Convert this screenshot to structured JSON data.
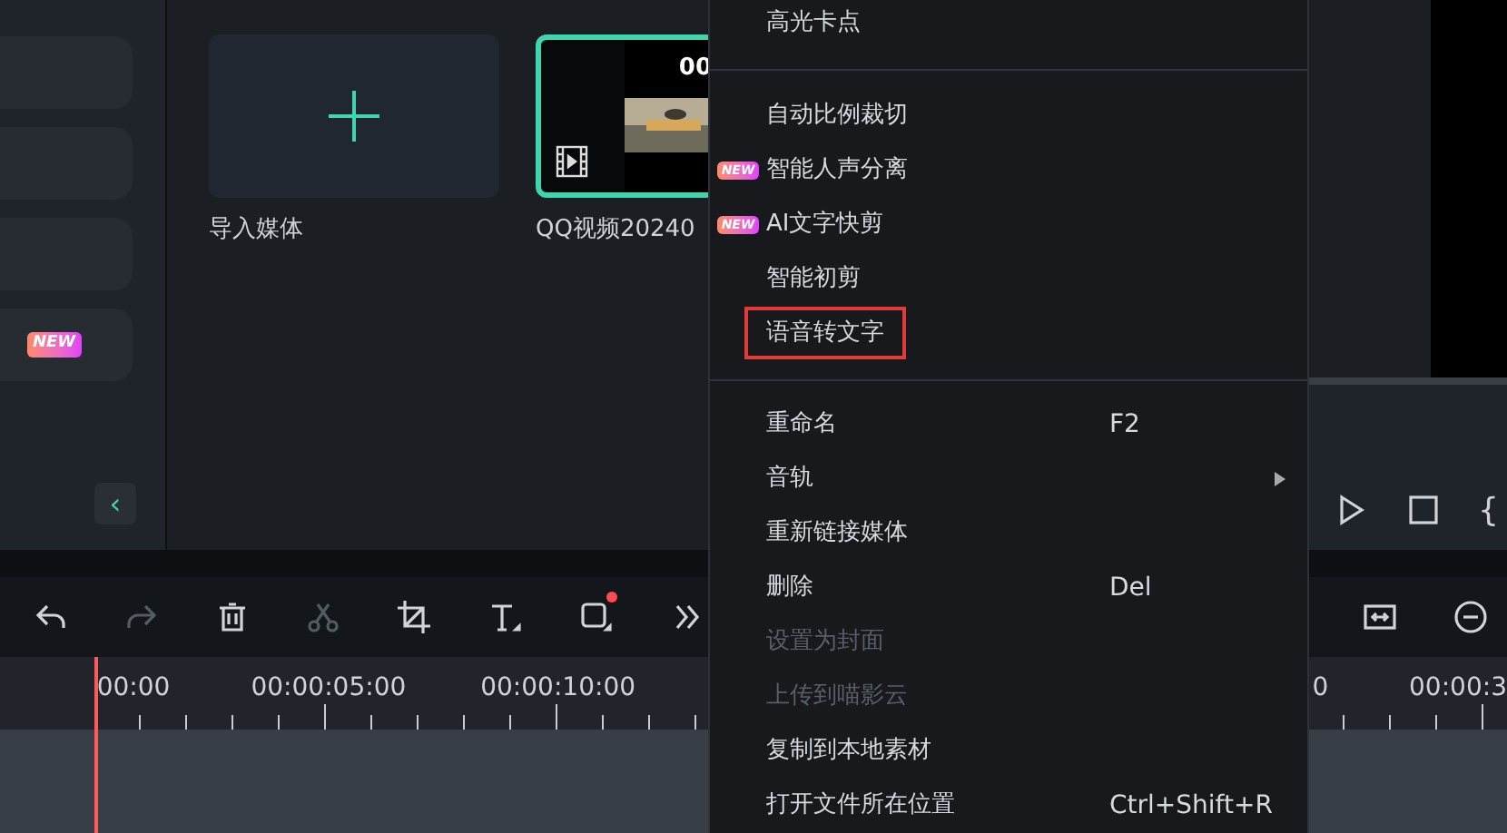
{
  "sidebar": {
    "items": [
      {
        "selected": false
      },
      {
        "selected": false
      },
      {
        "selected": false
      },
      {
        "selected": false,
        "badge": "NEW"
      }
    ],
    "collapse_button": "‹"
  },
  "player_controls": {
    "brace": "{"
  },
  "media": {
    "items": [
      {
        "kind": "import",
        "label": "导入媒体",
        "selected": false
      },
      {
        "kind": "video",
        "label": "QQ视频20240",
        "duration": "00",
        "selected": true
      }
    ]
  },
  "context_menu": {
    "items": [
      {
        "kind": "item",
        "label": "高光卡点",
        "disabled": false,
        "outlined": false
      },
      {
        "kind": "divider"
      },
      {
        "kind": "item",
        "label": "自动比例裁切",
        "disabled": false,
        "outlined": false
      },
      {
        "kind": "item",
        "label": "智能人声分离",
        "badge": "NEW",
        "disabled": false,
        "outlined": false
      },
      {
        "kind": "item",
        "label": "AI文字快剪",
        "badge": "NEW",
        "disabled": false,
        "outlined": false
      },
      {
        "kind": "item",
        "label": "智能初剪",
        "disabled": false,
        "outlined": false
      },
      {
        "kind": "item",
        "label": "语音转文字",
        "disabled": false,
        "outlined": true
      },
      {
        "kind": "divider"
      },
      {
        "kind": "item",
        "label": "重命名",
        "shortcut": "F2",
        "disabled": false,
        "outlined": false
      },
      {
        "kind": "item",
        "label": "音轨",
        "submenu": true,
        "disabled": false,
        "outlined": false
      },
      {
        "kind": "item",
        "label": "重新链接媒体",
        "disabled": false,
        "outlined": false
      },
      {
        "kind": "item",
        "label": "删除",
        "shortcut": "Del",
        "disabled": false,
        "outlined": false
      },
      {
        "kind": "item",
        "label": "设置为封面",
        "disabled": true,
        "outlined": false
      },
      {
        "kind": "item",
        "label": "上传到喵影云",
        "disabled": true,
        "outlined": false
      },
      {
        "kind": "item",
        "label": "复制到本地素材",
        "disabled": false,
        "outlined": false
      },
      {
        "kind": "item",
        "label": "打开文件所在位置",
        "shortcut": "Ctrl+Shift+R",
        "disabled": false,
        "outlined": false
      }
    ]
  },
  "toolbar": {
    "tools": [
      {
        "kind": "undo",
        "disabled": false
      },
      {
        "kind": "redo",
        "disabled": true
      },
      {
        "kind": "delete",
        "disabled": false
      },
      {
        "kind": "cut",
        "disabled": true
      },
      {
        "kind": "crop",
        "disabled": false
      },
      {
        "kind": "text",
        "disabled": false
      },
      {
        "kind": "shape",
        "disabled": false,
        "dot": true
      },
      {
        "kind": "more",
        "disabled": false
      }
    ]
  },
  "ruler": {
    "labels": [
      "00:00",
      "00:00:05:00",
      "00:00:10:00"
    ],
    "right_labels": [
      "0",
      "00:00:3"
    ]
  }
}
